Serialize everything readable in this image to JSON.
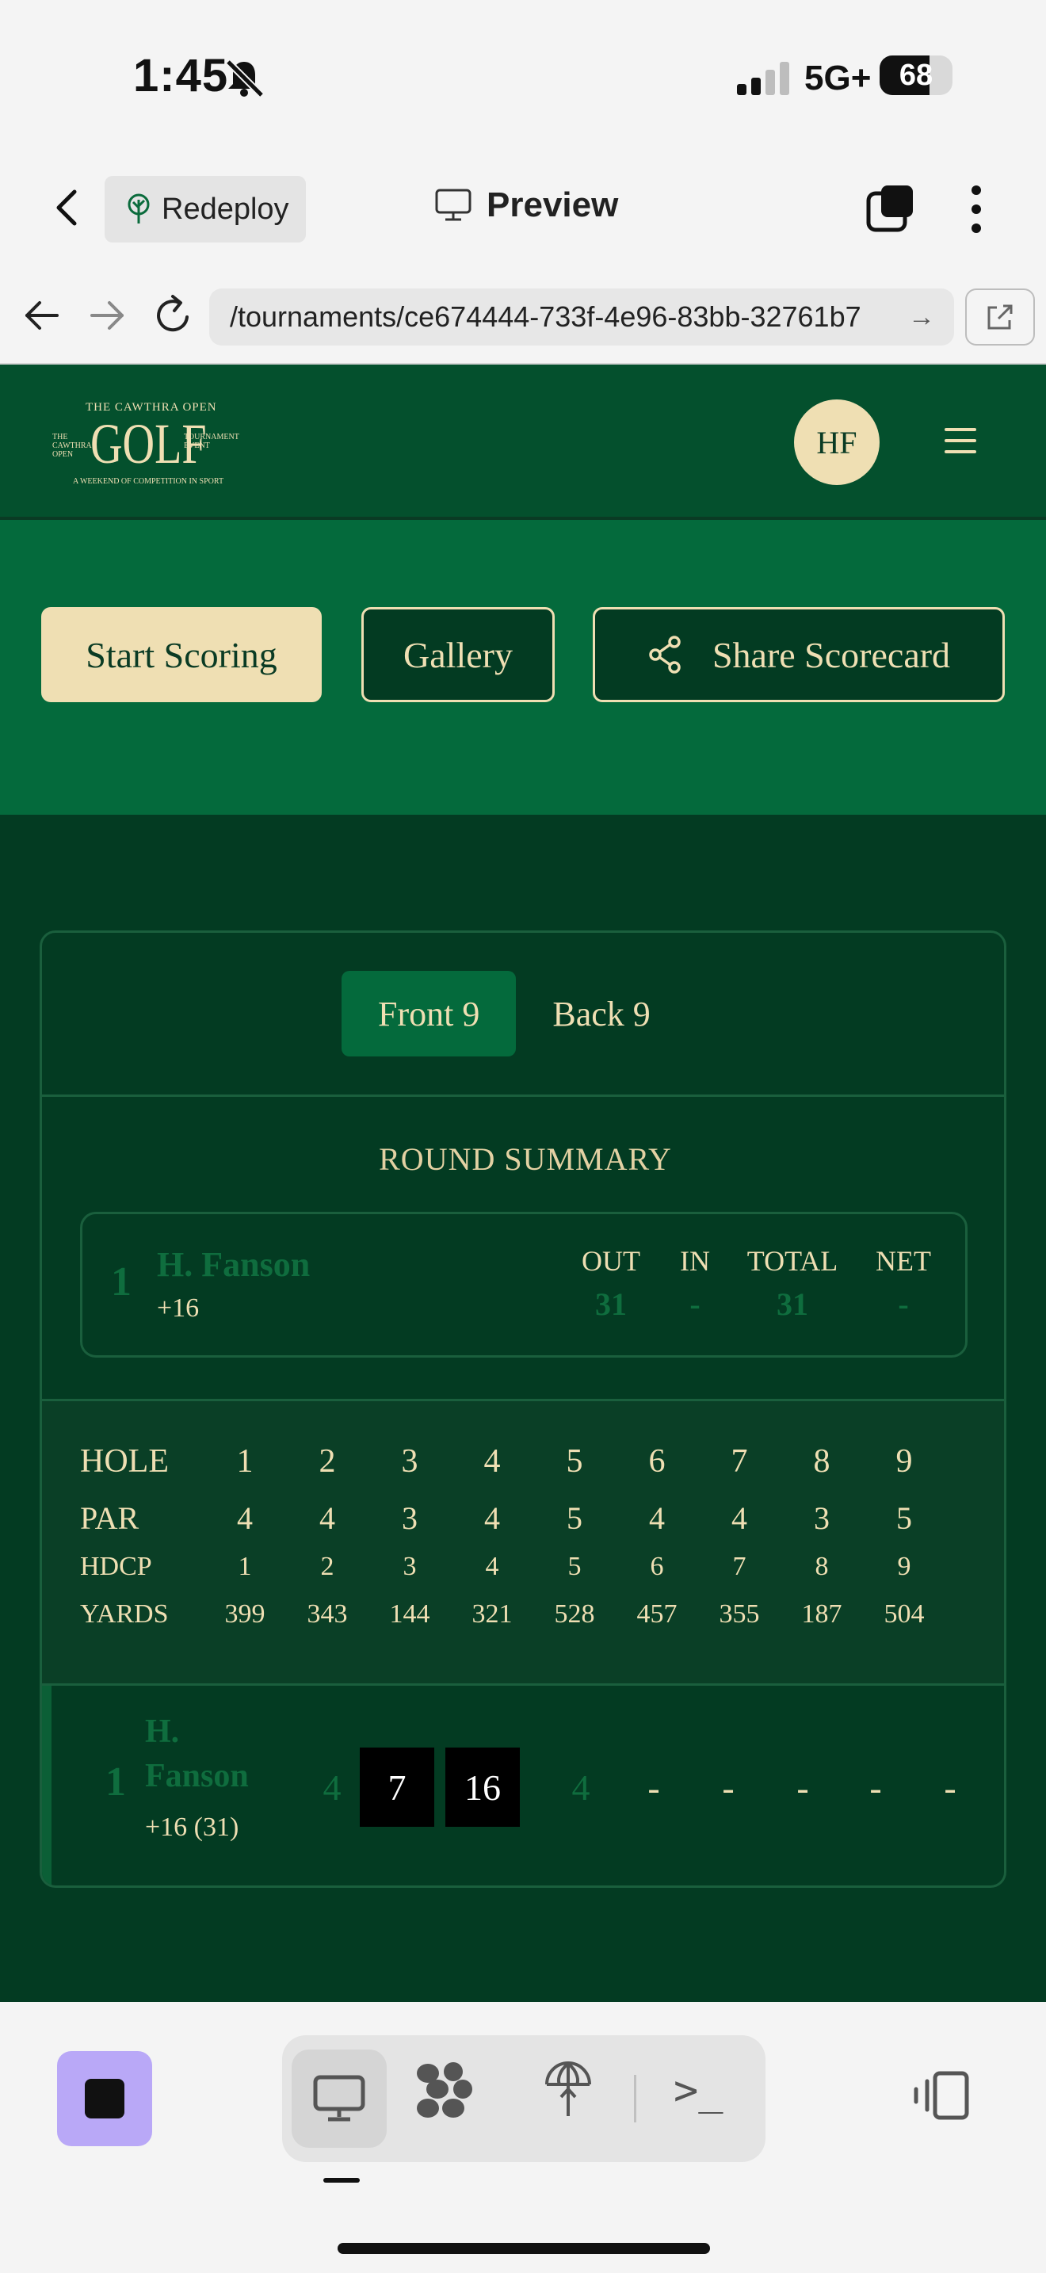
{
  "status_bar": {
    "time": "1:45",
    "network": "5G+",
    "battery": "68",
    "battery_level": 0.68,
    "mute_icon": "bell-slash-icon"
  },
  "app_bar": {
    "redeploy_label": "Redeploy",
    "preview_label": "Preview"
  },
  "url_bar": {
    "url": "/tournaments/ce674444-733f-4e96-83bb-32761b7"
  },
  "site": {
    "avatar_initials": "HF",
    "logo": {
      "line1": "THE CAWTHRA OPEN",
      "main": "GOLF",
      "left": "THE CAWTHRA OPEN",
      "right": "TOURNAMENT EVENT",
      "bottom": "A WEEKEND OF COMPETITION IN SPORT"
    }
  },
  "actions": {
    "start_scoring": "Start Scoring",
    "gallery": "Gallery",
    "share": "Share Scorecard"
  },
  "scorecard": {
    "tabs": [
      "Front 9",
      "Back 9"
    ],
    "active_tab": "Front 9",
    "summary_title": "ROUND SUMMARY",
    "summary": {
      "rank": "1",
      "name": "H. Fanson",
      "handicap": "+16",
      "columns": [
        {
          "label": "OUT",
          "value": "31"
        },
        {
          "label": "IN",
          "value": "-"
        },
        {
          "label": "TOTAL",
          "value": "31"
        },
        {
          "label": "NET",
          "value": "-"
        }
      ]
    },
    "rows": {
      "hole": {
        "label": "HOLE",
        "values": [
          "1",
          "2",
          "3",
          "4",
          "5",
          "6",
          "7",
          "8",
          "9"
        ]
      },
      "par": {
        "label": "PAR",
        "values": [
          "4",
          "4",
          "3",
          "4",
          "5",
          "4",
          "4",
          "3",
          "5"
        ]
      },
      "hdcp": {
        "label": "HDCP",
        "values": [
          "1",
          "2",
          "3",
          "4",
          "5",
          "6",
          "7",
          "8",
          "9"
        ]
      },
      "yards": {
        "label": "YARDS",
        "values": [
          "399",
          "343",
          "144",
          "321",
          "528",
          "457",
          "355",
          "187",
          "504"
        ]
      }
    },
    "player": {
      "rank": "1",
      "name_line1": "H.",
      "name_line2": "Fanson",
      "score_line": "+16 (31)",
      "scores": [
        "4",
        "7",
        "16",
        "4",
        "-",
        "-",
        "-",
        "-",
        "-"
      ]
    }
  },
  "colors": {
    "header_green": "#04502d",
    "hero_green": "#046a3c",
    "main_green": "#033b22",
    "cream": "#efdfb3",
    "stop_purple": "#b9a8f7"
  }
}
